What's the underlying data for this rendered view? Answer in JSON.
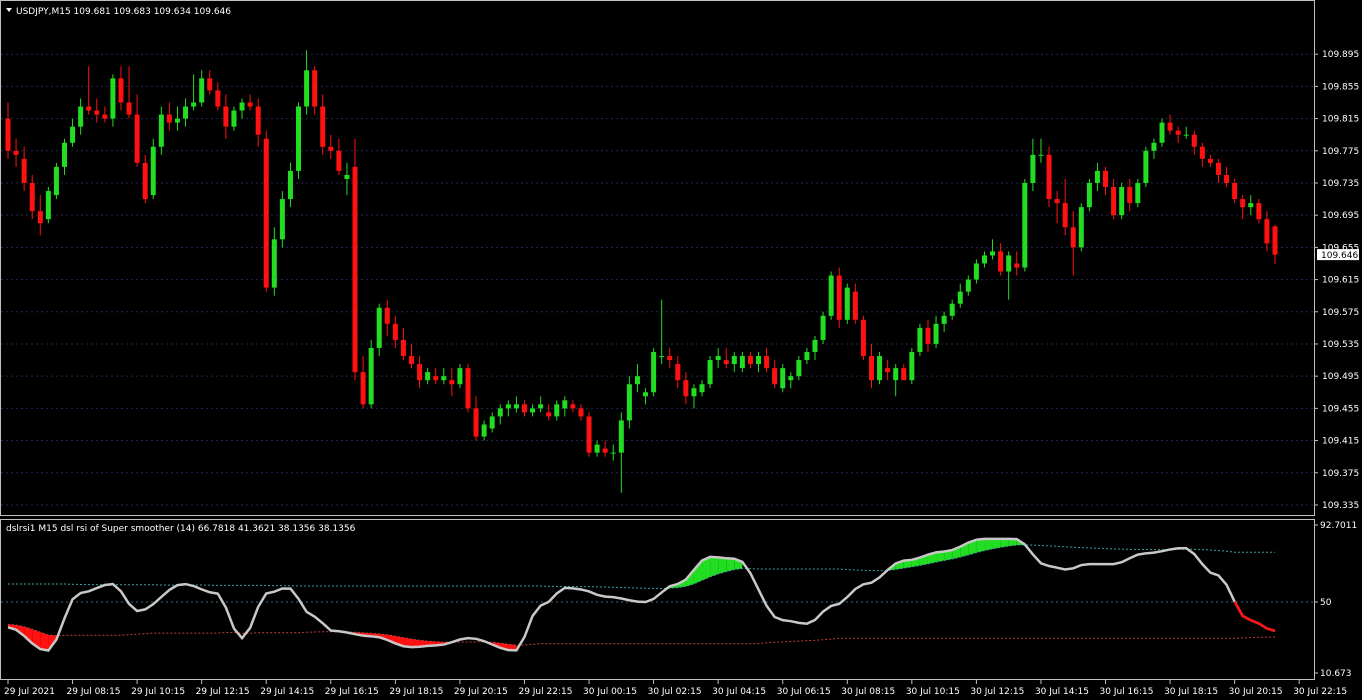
{
  "chart_data": {
    "type": "candlestick",
    "symbol": "USDJPY,M15",
    "title": "USDJPY,M15  109.681 109.683 109.634 109.646",
    "ohlc_header": "109.681 109.683 109.634 109.646",
    "current_price": "109.646",
    "price_ylim": [
      109.325,
      109.935
    ],
    "price_ticks": [
      "109.895",
      "109.855",
      "109.815",
      "109.775",
      "109.735",
      "109.695",
      "109.655",
      "109.615",
      "109.575",
      "109.535",
      "109.495",
      "109.455",
      "109.415",
      "109.375",
      "109.335"
    ],
    "colors": {
      "up": "#22dd22",
      "down": "#ff1111",
      "grid": "#1a2a50",
      "frame": "#c0c0c0",
      "osc_line": "#c8c8c8"
    },
    "candles": [
      [
        109.815,
        109.835,
        109.765,
        109.775
      ],
      [
        109.775,
        109.79,
        109.755,
        109.77
      ],
      [
        109.765,
        109.78,
        109.725,
        109.735
      ],
      [
        109.735,
        109.745,
        109.69,
        109.7
      ],
      [
        109.7,
        109.72,
        109.67,
        109.685
      ],
      [
        109.69,
        109.73,
        109.685,
        109.725
      ],
      [
        109.72,
        109.76,
        109.715,
        109.755
      ],
      [
        109.755,
        109.79,
        109.745,
        109.785
      ],
      [
        109.785,
        109.815,
        109.78,
        109.805
      ],
      [
        109.805,
        109.84,
        109.795,
        109.83
      ],
      [
        109.83,
        109.88,
        109.82,
        109.825
      ],
      [
        109.825,
        109.84,
        109.81,
        109.82
      ],
      [
        109.82,
        109.83,
        109.81,
        109.815
      ],
      [
        109.815,
        109.87,
        109.805,
        109.865
      ],
      [
        109.865,
        109.88,
        109.825,
        109.835
      ],
      [
        109.835,
        109.88,
        109.815,
        109.82
      ],
      [
        109.82,
        109.845,
        109.755,
        109.76
      ],
      [
        109.76,
        109.77,
        109.71,
        109.715
      ],
      [
        109.72,
        109.79,
        109.715,
        109.78
      ],
      [
        109.78,
        109.83,
        109.77,
        109.82
      ],
      [
        109.82,
        109.835,
        109.8,
        109.81
      ],
      [
        109.81,
        109.83,
        109.8,
        109.815
      ],
      [
        109.815,
        109.84,
        109.805,
        109.83
      ],
      [
        109.83,
        109.87,
        109.825,
        109.835
      ],
      [
        109.835,
        109.875,
        109.83,
        109.865
      ],
      [
        109.865,
        109.875,
        109.845,
        109.85
      ],
      [
        109.85,
        109.86,
        109.825,
        109.83
      ],
      [
        109.83,
        109.845,
        109.79,
        109.805
      ],
      [
        109.805,
        109.83,
        109.8,
        109.825
      ],
      [
        109.825,
        109.84,
        109.815,
        109.835
      ],
      [
        109.835,
        109.845,
        109.825,
        109.83
      ],
      [
        109.83,
        109.84,
        109.78,
        109.795
      ],
      [
        109.79,
        109.8,
        109.6,
        109.605
      ],
      [
        109.605,
        109.68,
        109.595,
        109.665
      ],
      [
        109.665,
        109.725,
        109.655,
        109.715
      ],
      [
        109.715,
        109.76,
        109.705,
        109.75
      ],
      [
        109.75,
        109.835,
        109.74,
        109.83
      ],
      [
        109.83,
        109.9,
        109.82,
        109.875
      ],
      [
        109.875,
        109.88,
        109.82,
        109.83
      ],
      [
        109.83,
        109.845,
        109.77,
        109.78
      ],
      [
        109.78,
        109.795,
        109.765,
        109.775
      ],
      [
        109.775,
        109.79,
        109.745,
        109.75
      ],
      [
        109.74,
        109.76,
        109.72,
        109.745
      ],
      [
        109.755,
        109.79,
        109.49,
        109.5
      ],
      [
        109.5,
        109.52,
        109.455,
        109.46
      ],
      [
        109.46,
        109.54,
        109.455,
        109.53
      ],
      [
        109.53,
        109.585,
        109.52,
        109.58
      ],
      [
        109.58,
        109.59,
        109.545,
        109.56
      ],
      [
        109.56,
        109.57,
        109.53,
        109.54
      ],
      [
        109.54,
        109.555,
        109.515,
        109.52
      ],
      [
        109.52,
        109.535,
        109.505,
        109.51
      ],
      [
        109.51,
        109.52,
        109.48,
        109.49
      ],
      [
        109.49,
        109.505,
        109.485,
        109.5
      ],
      [
        109.495,
        109.505,
        109.485,
        109.49
      ],
      [
        109.49,
        109.505,
        109.485,
        109.495
      ],
      [
        109.49,
        109.505,
        109.47,
        109.485
      ],
      [
        109.485,
        109.51,
        109.48,
        109.505
      ],
      [
        109.505,
        109.51,
        109.45,
        109.455
      ],
      [
        109.455,
        109.47,
        109.415,
        109.42
      ],
      [
        109.42,
        109.44,
        109.415,
        109.435
      ],
      [
        109.43,
        109.45,
        109.425,
        109.445
      ],
      [
        109.445,
        109.46,
        109.435,
        109.455
      ],
      [
        109.455,
        109.465,
        109.445,
        109.46
      ],
      [
        109.455,
        109.47,
        109.45,
        109.46
      ],
      [
        109.46,
        109.465,
        109.445,
        109.45
      ],
      [
        109.45,
        109.46,
        109.445,
        109.455
      ],
      [
        109.455,
        109.47,
        109.45,
        109.46
      ],
      [
        109.45,
        109.46,
        109.44,
        109.445
      ],
      [
        109.445,
        109.465,
        109.44,
        109.46
      ],
      [
        109.455,
        109.47,
        109.445,
        109.465
      ],
      [
        109.46,
        109.465,
        109.45,
        109.455
      ],
      [
        109.455,
        109.46,
        109.44,
        109.445
      ],
      [
        109.445,
        109.45,
        109.395,
        109.4
      ],
      [
        109.4,
        109.415,
        109.395,
        109.41
      ],
      [
        109.405,
        109.415,
        109.395,
        109.4
      ],
      [
        109.4,
        109.41,
        109.39,
        109.4
      ],
      [
        109.4,
        109.45,
        109.35,
        109.44
      ],
      [
        109.44,
        109.495,
        109.43,
        109.485
      ],
      [
        109.485,
        109.51,
        109.475,
        109.495
      ],
      [
        109.47,
        109.48,
        109.46,
        109.475
      ],
      [
        109.475,
        109.53,
        109.47,
        109.525
      ],
      [
        109.52,
        109.59,
        109.51,
        109.52
      ],
      [
        109.52,
        109.53,
        109.505,
        109.515
      ],
      [
        109.51,
        109.52,
        109.48,
        109.49
      ],
      [
        109.49,
        109.5,
        109.46,
        109.47
      ],
      [
        109.47,
        109.485,
        109.455,
        109.48
      ],
      [
        109.475,
        109.49,
        109.47,
        109.485
      ],
      [
        109.485,
        109.52,
        109.48,
        109.515
      ],
      [
        109.515,
        109.53,
        109.505,
        109.52
      ],
      [
        109.515,
        109.53,
        109.505,
        109.51
      ],
      [
        109.51,
        109.525,
        109.5,
        109.52
      ],
      [
        109.505,
        109.525,
        109.5,
        109.52
      ],
      [
        109.52,
        109.525,
        109.505,
        109.51
      ],
      [
        109.51,
        109.525,
        109.5,
        109.52
      ],
      [
        109.52,
        109.53,
        109.5,
        109.505
      ],
      [
        109.505,
        109.515,
        109.48,
        109.485
      ],
      [
        109.48,
        109.51,
        109.475,
        109.505
      ],
      [
        109.49,
        109.5,
        109.48,
        109.495
      ],
      [
        109.495,
        109.52,
        109.49,
        109.515
      ],
      [
        109.515,
        109.53,
        109.51,
        109.525
      ],
      [
        109.525,
        109.545,
        109.515,
        109.54
      ],
      [
        109.54,
        109.575,
        109.535,
        109.57
      ],
      [
        109.57,
        109.625,
        109.565,
        109.62
      ],
      [
        109.62,
        109.63,
        109.555,
        109.565
      ],
      [
        109.565,
        109.61,
        109.56,
        109.605
      ],
      [
        109.6,
        109.61,
        109.56,
        109.565
      ],
      [
        109.565,
        109.57,
        109.515,
        109.52
      ],
      [
        109.52,
        109.535,
        109.48,
        109.49
      ],
      [
        109.49,
        109.525,
        109.485,
        109.52
      ],
      [
        109.505,
        109.515,
        109.49,
        109.5
      ],
      [
        109.49,
        109.51,
        109.47,
        109.505
      ],
      [
        109.505,
        109.51,
        109.49,
        109.49
      ],
      [
        109.49,
        109.53,
        109.485,
        109.525
      ],
      [
        109.525,
        109.56,
        109.52,
        109.555
      ],
      [
        109.555,
        109.565,
        109.525,
        109.535
      ],
      [
        109.535,
        109.57,
        109.53,
        109.56
      ],
      [
        109.56,
        109.575,
        109.55,
        109.57
      ],
      [
        109.57,
        109.59,
        109.565,
        109.585
      ],
      [
        109.585,
        109.61,
        109.58,
        109.6
      ],
      [
        109.6,
        109.62,
        109.595,
        109.615
      ],
      [
        109.615,
        109.64,
        109.61,
        109.635
      ],
      [
        109.635,
        109.65,
        109.63,
        109.645
      ],
      [
        109.645,
        109.665,
        109.64,
        109.65
      ],
      [
        109.65,
        109.66,
        109.62,
        109.625
      ],
      [
        109.625,
        109.65,
        109.59,
        109.645
      ],
      [
        109.635,
        109.65,
        109.62,
        109.63
      ],
      [
        109.63,
        109.74,
        109.625,
        109.735
      ],
      [
        109.735,
        109.79,
        109.725,
        109.77
      ],
      [
        109.77,
        109.79,
        109.76,
        109.77
      ],
      [
        109.77,
        109.78,
        109.705,
        109.715
      ],
      [
        109.715,
        109.725,
        109.685,
        109.71
      ],
      [
        109.71,
        109.74,
        109.67,
        109.68
      ],
      [
        109.68,
        109.7,
        109.62,
        109.655
      ],
      [
        109.655,
        109.71,
        109.65,
        109.705
      ],
      [
        109.705,
        109.74,
        109.7,
        109.735
      ],
      [
        109.735,
        109.76,
        109.725,
        109.75
      ],
      [
        109.75,
        109.755,
        109.72,
        109.73
      ],
      [
        109.73,
        109.74,
        109.69,
        109.695
      ],
      [
        109.695,
        109.735,
        109.69,
        109.73
      ],
      [
        109.73,
        109.74,
        109.7,
        109.71
      ],
      [
        109.71,
        109.74,
        109.705,
        109.735
      ],
      [
        109.735,
        109.78,
        109.73,
        109.775
      ],
      [
        109.775,
        109.79,
        109.765,
        109.785
      ],
      [
        109.785,
        109.815,
        109.78,
        109.81
      ],
      [
        109.81,
        109.82,
        109.795,
        109.8
      ],
      [
        109.8,
        109.805,
        109.785,
        109.795
      ],
      [
        109.795,
        109.805,
        109.79,
        109.795
      ],
      [
        109.795,
        109.8,
        109.77,
        109.78
      ],
      [
        109.78,
        109.785,
        109.755,
        109.765
      ],
      [
        109.765,
        109.77,
        109.755,
        109.76
      ],
      [
        109.76,
        109.765,
        109.735,
        109.745
      ],
      [
        109.745,
        109.755,
        109.73,
        109.735
      ],
      [
        109.735,
        109.74,
        109.71,
        109.715
      ],
      [
        109.715,
        109.72,
        109.69,
        109.705
      ],
      [
        109.705,
        109.72,
        109.695,
        109.71
      ],
      [
        109.71,
        109.715,
        109.685,
        109.69
      ],
      [
        109.69,
        109.7,
        109.65,
        109.66
      ],
      [
        109.681,
        109.683,
        109.634,
        109.646
      ]
    ],
    "indicator": {
      "title": "dslrsi1 M15 dsl rsi of Super smoother (14) 66.7818 41.3621 38.1356 38.1356",
      "ylim": [
        10.673,
        92.7011
      ],
      "ticks": [
        "92.7011",
        "50",
        "10.673"
      ],
      "level": 50
    },
    "x_ticks": [
      {
        "label": "29 Jul 2021",
        "i": 0
      },
      {
        "label": "29 Jul 08:15",
        "i": 8
      },
      {
        "label": "29 Jul 10:15",
        "i": 16
      },
      {
        "label": "29 Jul 12:15",
        "i": 24
      },
      {
        "label": "29 Jul 14:15",
        "i": 32
      },
      {
        "label": "29 Jul 16:15",
        "i": 40
      },
      {
        "label": "29 Jul 18:15",
        "i": 48
      },
      {
        "label": "29 Jul 20:15",
        "i": 56
      },
      {
        "label": "29 Jul 22:15",
        "i": 64
      },
      {
        "label": "30 Jul 00:15",
        "i": 72
      },
      {
        "label": "30 Jul 02:15",
        "i": 80
      },
      {
        "label": "30 Jul 04:15",
        "i": 88
      },
      {
        "label": "30 Jul 06:15",
        "i": 96
      },
      {
        "label": "30 Jul 08:15",
        "i": 104
      },
      {
        "label": "30 Jul 10:15",
        "i": 112
      },
      {
        "label": "30 Jul 12:15",
        "i": 120
      },
      {
        "label": "30 Jul 14:15",
        "i": 128
      },
      {
        "label": "30 Jul 16:15",
        "i": 136
      },
      {
        "label": "30 Jul 18:15",
        "i": 144
      },
      {
        "label": "30 Jul 20:15",
        "i": 152
      },
      {
        "label": "30 Jul 22:15",
        "i": 160
      }
    ]
  }
}
